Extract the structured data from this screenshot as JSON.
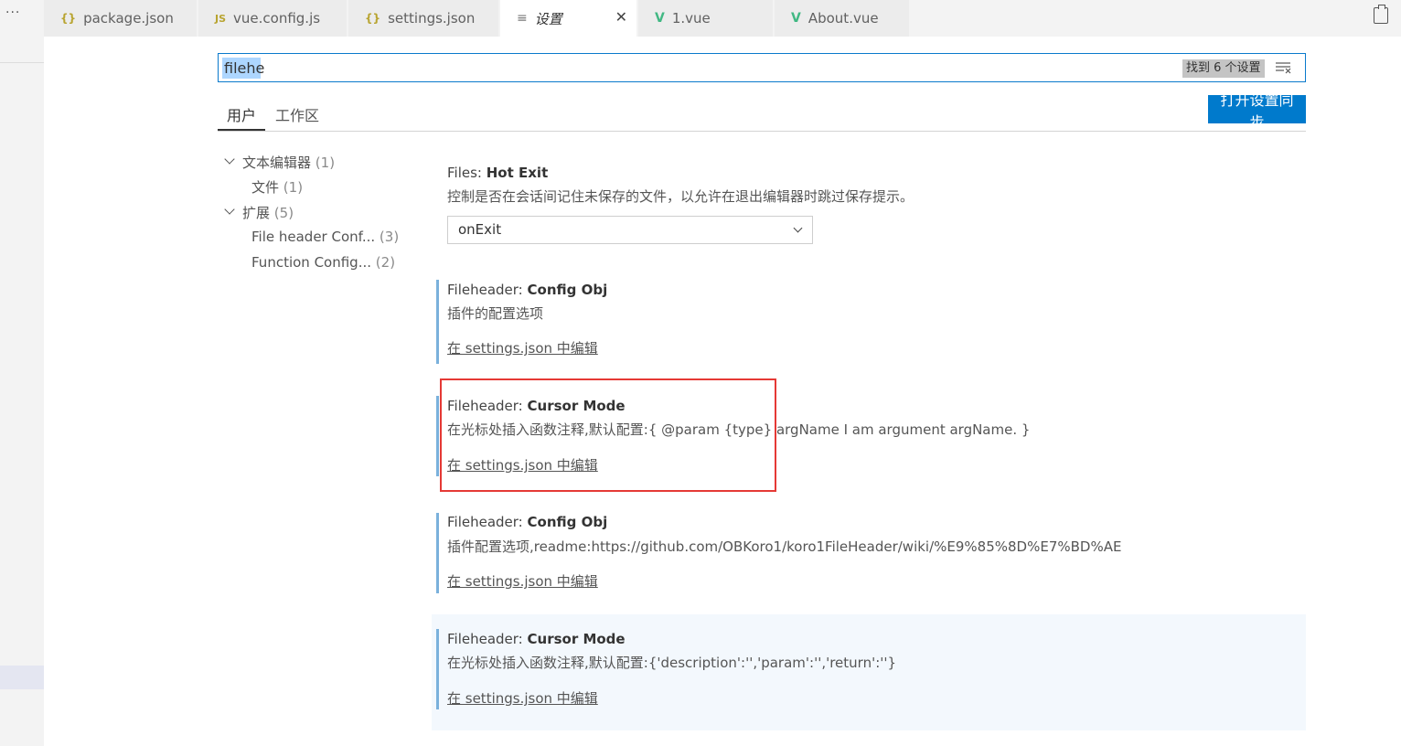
{
  "left_strip": {
    "more_label": "···"
  },
  "tabs": [
    {
      "icon": "{}",
      "label": "package.json"
    },
    {
      "icon": "JS",
      "label": "vue.config.js"
    },
    {
      "icon": "{}",
      "label": "settings.json"
    },
    {
      "icon": "≡",
      "label": "设置",
      "close": "✕"
    },
    {
      "icon": "V",
      "label": "1.vue"
    },
    {
      "icon": "V",
      "label": "About.vue"
    }
  ],
  "search": {
    "value": "filehe",
    "result_count": "找到 6 个设置"
  },
  "scopes": {
    "user": "用户",
    "workspace": "工作区",
    "sync_button": "打开设置同步"
  },
  "toc": [
    {
      "label": "文本编辑器",
      "count": "(1)"
    },
    {
      "label": "文件",
      "count": "(1)"
    },
    {
      "label": "扩展",
      "count": "(5)"
    },
    {
      "label": "File header Conf...",
      "count": "(3)"
    },
    {
      "label": "Function Config...",
      "count": "(2)"
    }
  ],
  "settings": [
    {
      "category": "Files: ",
      "name": "Hot Exit",
      "description": "控制是否在会话间记住未保存的文件，以允许在退出编辑器时跳过保存提示。",
      "value": "onExit"
    },
    {
      "category": "Fileheader: ",
      "name": "Config Obj",
      "description": "插件的配置选项",
      "link": "在 settings.json 中编辑"
    },
    {
      "category": "Fileheader: ",
      "name": "Cursor Mode",
      "description": "在光标处插入函数注释,默认配置:{ @param {type} argName I am argument argName. }",
      "link": "在 settings.json 中编辑"
    },
    {
      "category": "Fileheader: ",
      "name": "Config Obj",
      "description": "插件配置选项,readme:https://github.com/OBKoro1/koro1FileHeader/wiki/%E9%85%8D%E7%BD%AE",
      "link": "在 settings.json 中编辑"
    },
    {
      "category": "Fileheader: ",
      "name": "Cursor Mode",
      "description": "在光标处插入函数注释,默认配置:{'description':'','param':'','return':''}",
      "link": "在 settings.json 中编辑"
    }
  ],
  "colors": {
    "accent": "#007acc",
    "highlight_box": "#e53935",
    "modified_bar": "#7ab1dc"
  }
}
